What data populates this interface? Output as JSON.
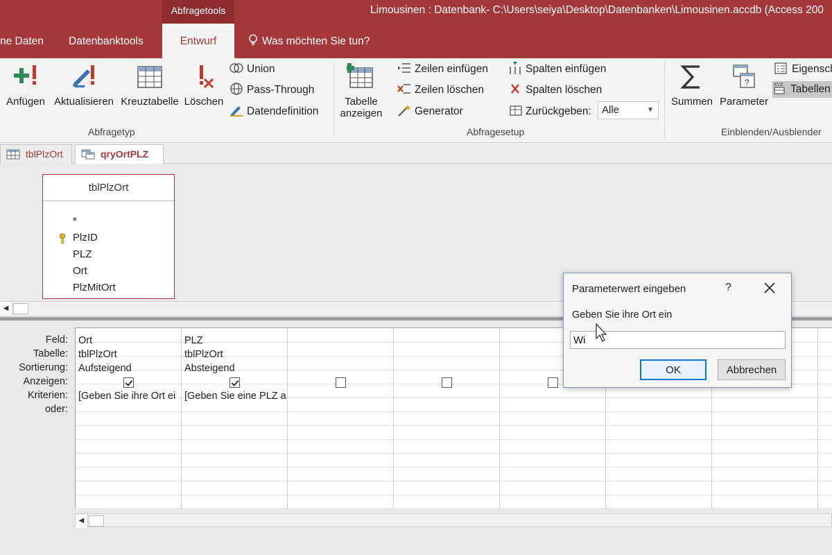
{
  "titlebar": {
    "context_tab": "Abfragetools",
    "window_title": "Limousinen : Datenbank- C:\\Users\\seiya\\Desktop\\Datenbanken\\Limousinen.accdb (Access 200"
  },
  "ribbon_tabs": {
    "external_data": "ne Daten",
    "database_tools": "Datenbanktools",
    "design": "Entwurf",
    "tell_me": "Was möchten Sie tun?"
  },
  "ribbon": {
    "query_type": {
      "append": "Anfügen",
      "update": "Aktualisieren",
      "crosstab": "Kreuztabelle",
      "delete": "Löschen",
      "union": "Union",
      "pass_through": "Pass-Through",
      "data_definition": "Datendefinition",
      "group_label": "Abfragetyp"
    },
    "query_setup": {
      "show_table_line1": "Tabelle",
      "show_table_line2": "anzeigen",
      "insert_rows": "Zeilen einfügen",
      "delete_rows": "Zeilen löschen",
      "builder": "Generator",
      "insert_columns": "Spalten einfügen",
      "delete_columns": "Spalten löschen",
      "return": "Zurückgeben:",
      "return_value": "Alle",
      "group_label": "Abfragesetup"
    },
    "show_hide": {
      "totals": "Summen",
      "parameters": "Parameter",
      "property_sheet": "Eigensch",
      "table_names": "Tabellen",
      "group_label": "Einblenden/Ausblender"
    }
  },
  "doc_tabs": {
    "table_tab": "tblPlzOrt",
    "query_tab": "qryOrtPLZ"
  },
  "field_list": {
    "title": "tblPlzOrt",
    "fields": [
      "*",
      "PlzID",
      "PLZ",
      "Ort",
      "PlzMitOrt"
    ]
  },
  "design_grid": {
    "row_labels": {
      "field": "Feld:",
      "table": "Tabelle:",
      "sort": "Sortierung:",
      "show": "Anzeigen:",
      "criteria": "Kriterien:",
      "or": "oder:"
    },
    "columns": [
      {
        "field": "Ort",
        "table": "tblPlzOrt",
        "sort": "Aufsteigend",
        "show": true,
        "criteria": "[Geben Sie ihre Ort ei"
      },
      {
        "field": "PLZ",
        "table": "tblPlzOrt",
        "sort": "Absteigend",
        "show": true,
        "criteria": "[Geben Sie eine PLZ a"
      }
    ]
  },
  "dialog": {
    "title": "Parameterwert eingeben",
    "help": "?",
    "prompt": "Geben Sie ihre Ort ein",
    "input_value": "Wi",
    "ok": "OK",
    "cancel": "Abbrechen"
  },
  "colors": {
    "accent": "#a4373a",
    "ribbon_bg": "#f3f3f3"
  }
}
